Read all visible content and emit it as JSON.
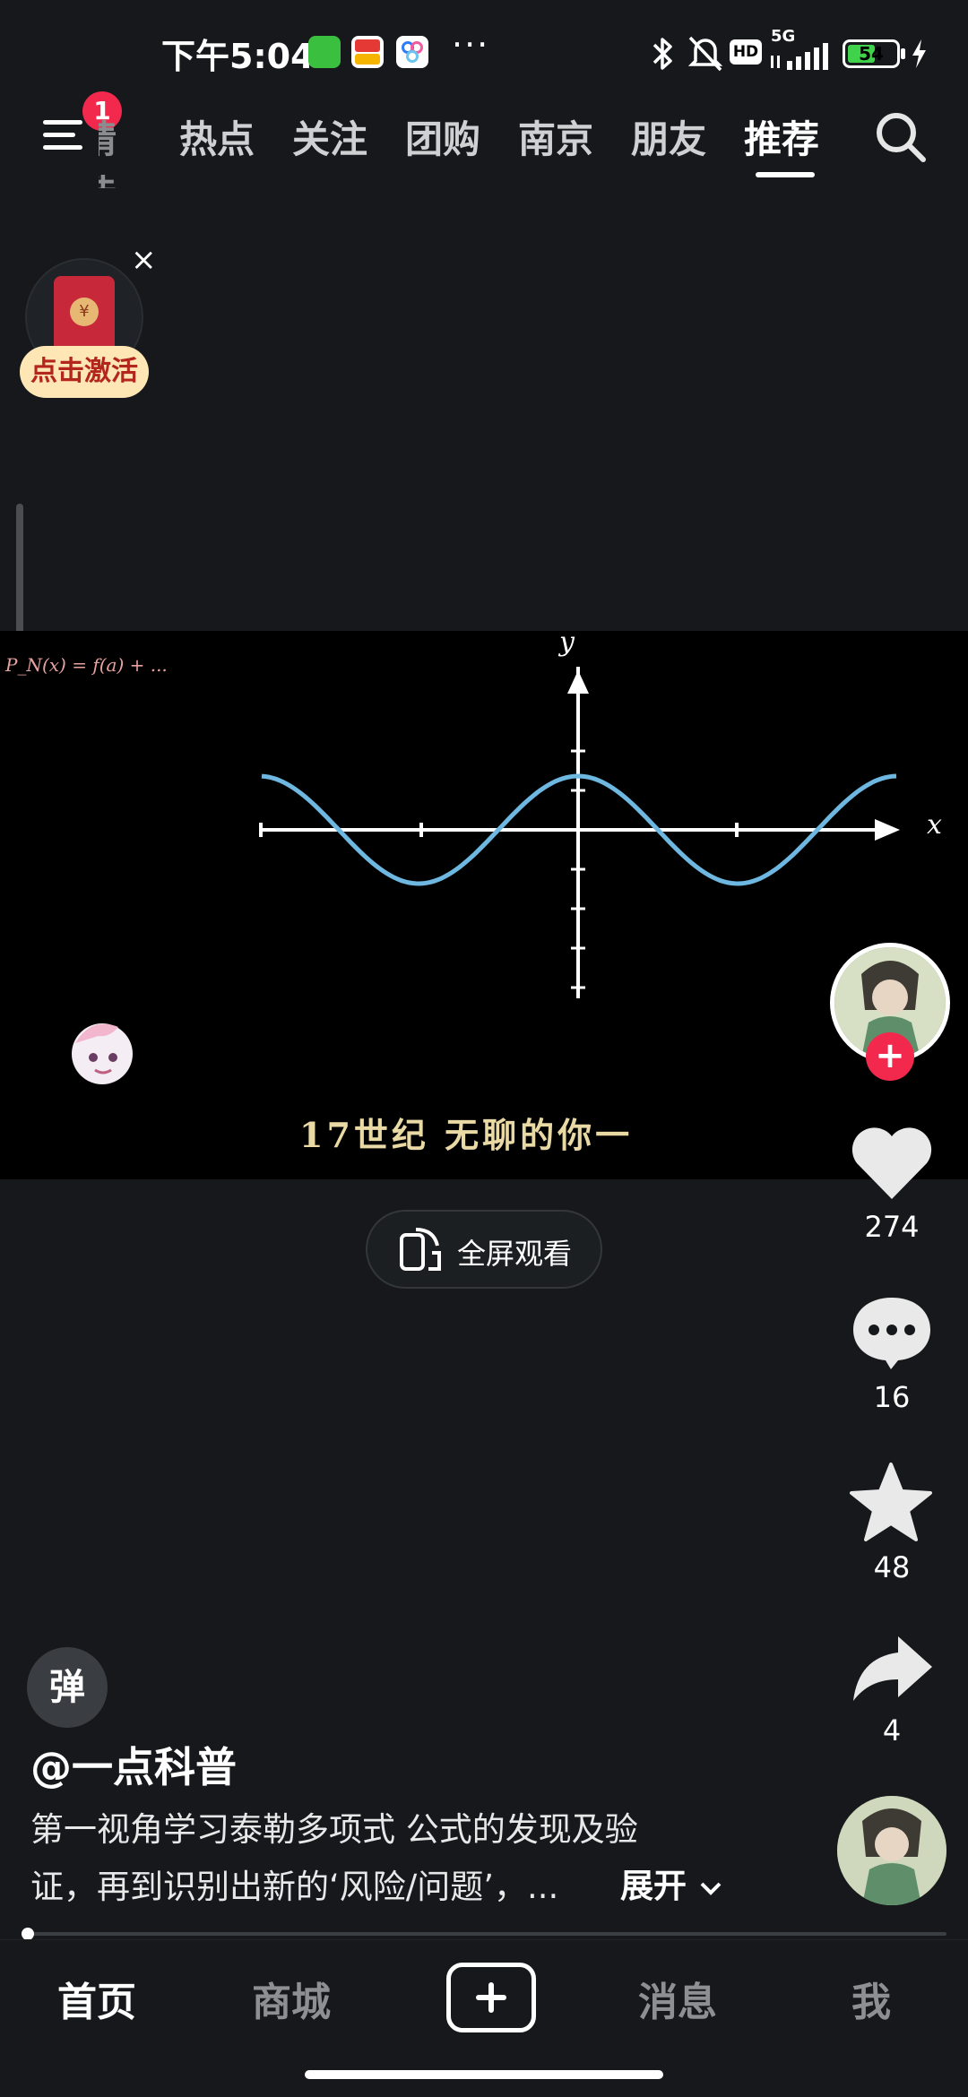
{
  "status_bar": {
    "time": "下午5:04",
    "dots": "···",
    "network": "5G",
    "hd": "HD",
    "battery": "54",
    "battery_percent": 54
  },
  "top_nav": {
    "menu_badge": "1",
    "tabs": [
      {
        "label": "精选",
        "active": false
      },
      {
        "label": "热点",
        "active": false
      },
      {
        "label": "关注",
        "active": false
      },
      {
        "label": "团购",
        "active": false
      },
      {
        "label": "南京",
        "active": false
      },
      {
        "label": "朋友",
        "active": false
      },
      {
        "label": "推荐",
        "active": true
      }
    ],
    "search_icon": "search-icon"
  },
  "red_packet": {
    "label": "点击激活",
    "close": "×",
    "seal": "¥"
  },
  "video": {
    "formula": "P_N(x) = f(a) + ...",
    "subtitle": "17世纪 无聊的你一",
    "graph": {
      "x_axis_label": "x",
      "y_axis_label": "y",
      "curve": "cos",
      "curve_color": "#6db7e1"
    }
  },
  "fullscreen": {
    "label": "全屏观看"
  },
  "right_rail": {
    "likes": "274",
    "comments": "16",
    "favorites": "48",
    "shares": "4",
    "follow": "+"
  },
  "caption": {
    "danmu": "弹",
    "author": "@一点科普",
    "line1": "第一视角学习泰勒多项式 公式的发现及验",
    "line2": "证，再到识别出新的‘风险/问题’，...",
    "expand": "展开"
  },
  "playback": {
    "progress_fraction": 0.0
  },
  "bottom_bar": {
    "home": "首页",
    "mall": "商城",
    "messages": "消息",
    "me": "我"
  }
}
